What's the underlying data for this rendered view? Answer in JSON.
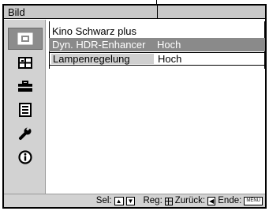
{
  "title": "Bild",
  "sidebar": {
    "items": [
      {
        "icon": "picture-icon",
        "active": true
      },
      {
        "icon": "screen-icon",
        "active": false
      },
      {
        "icon": "toolbox-icon",
        "active": false
      },
      {
        "icon": "menu-list-icon",
        "active": false
      },
      {
        "icon": "wrench-icon",
        "active": false
      },
      {
        "icon": "info-icon",
        "active": false
      }
    ]
  },
  "menu": {
    "rows": [
      {
        "label": "Kino Schwarz plus",
        "value": ""
      },
      {
        "label": "Dyn. HDR-Enhancer",
        "value": "Hoch"
      },
      {
        "label": "Lampenregelung",
        "value": "Hoch"
      }
    ]
  },
  "footer": {
    "select_label": "Sel:",
    "set_label": "Reg:",
    "back_label": "Zurück:",
    "end_label": "Ende:",
    "menu_key": "MENU",
    "up_key": "▲",
    "down_key": "▼",
    "left_key": "◀"
  }
}
